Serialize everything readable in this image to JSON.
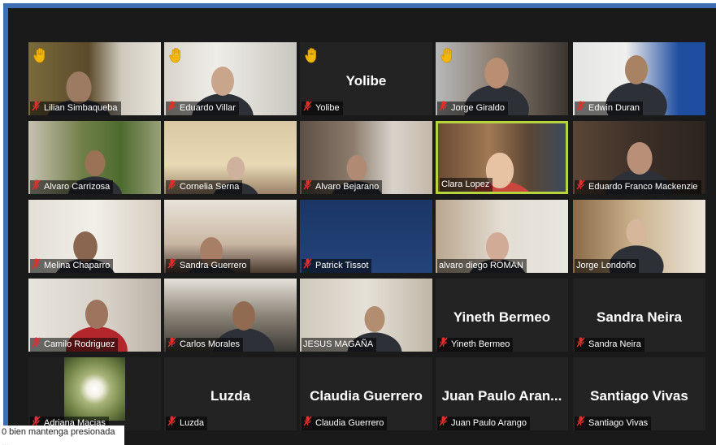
{
  "meeting": {
    "participants": [
      {
        "name": "Lilian Simbaqueba",
        "hand_raised": true,
        "mic": "muted-icon",
        "video": true
      },
      {
        "name": "Eduardo Villar",
        "hand_raised": true,
        "mic": "muted-icon",
        "video": true
      },
      {
        "name": "Yolibe",
        "hand_raised": true,
        "mic": "muted-icon",
        "video": false,
        "display_text": "Yolibe"
      },
      {
        "name": "Jorge Giraldo",
        "hand_raised": true,
        "mic": "muted-icon",
        "video": true
      },
      {
        "name": "Edwin Duran",
        "hand_raised": false,
        "mic": "muted-icon",
        "video": true
      },
      {
        "name": "Alvaro Carrizosa",
        "hand_raised": false,
        "mic": "muted-icon",
        "video": true
      },
      {
        "name": "Cornelia Serna",
        "hand_raised": false,
        "mic": "muted-icon",
        "video": true
      },
      {
        "name": "Alvaro Bejarano",
        "hand_raised": false,
        "mic": "muted-icon",
        "video": true
      },
      {
        "name": "Clara Lopez",
        "hand_raised": false,
        "mic": "none",
        "video": true,
        "active_speaker": true
      },
      {
        "name": "Eduardo Franco Mackenzie",
        "hand_raised": false,
        "mic": "muted-icon",
        "video": true
      },
      {
        "name": "Melina Chaparro",
        "hand_raised": false,
        "mic": "muted-icon",
        "video": true
      },
      {
        "name": "Sandra Guerrero",
        "hand_raised": false,
        "mic": "muted-icon",
        "video": true
      },
      {
        "name": "Patrick Tissot",
        "hand_raised": false,
        "mic": "muted-icon",
        "video": true
      },
      {
        "name": "alvaro diego ROMAN",
        "hand_raised": false,
        "mic": "none",
        "video": true
      },
      {
        "name": "Jorge Londoño",
        "hand_raised": false,
        "mic": "none",
        "video": true
      },
      {
        "name": "Camilo Rodriguez",
        "hand_raised": false,
        "mic": "muted-icon",
        "video": true
      },
      {
        "name": "Carlos Morales",
        "hand_raised": false,
        "mic": "muted-icon",
        "video": true
      },
      {
        "name": "JESUS MAGAÑA",
        "hand_raised": false,
        "mic": "none",
        "video": true
      },
      {
        "name": "Yineth Bermeo",
        "hand_raised": false,
        "mic": "muted-icon",
        "video": false,
        "display_text": "Yineth Bermeo"
      },
      {
        "name": "Sandra Neira",
        "hand_raised": false,
        "mic": "muted-icon",
        "video": false,
        "display_text": "Sandra Neira"
      },
      {
        "name": "Adriana Macias",
        "hand_raised": false,
        "mic": "muted-icon",
        "video": true
      },
      {
        "name": "Luzda",
        "hand_raised": false,
        "mic": "muted-icon",
        "video": false,
        "display_text": "Luzda"
      },
      {
        "name": "Claudia Guerrero",
        "hand_raised": false,
        "mic": "muted-icon",
        "video": false,
        "display_text": "Claudia Guerrero"
      },
      {
        "name": "Juan Paulo Arango",
        "hand_raised": false,
        "mic": "muted-icon",
        "video": false,
        "display_text": "Juan Paulo Aran..."
      },
      {
        "name": "Santiago Vivas",
        "hand_raised": false,
        "mic": "muted-icon",
        "video": false,
        "display_text": "Santiago Vivas"
      }
    ],
    "tooltip": {
      "line1": "0 bien mantenga presionada",
      "line2": "..."
    },
    "colors": {
      "frame": "#3d6fb5",
      "stage": "#1a1a1a",
      "active_border": "#b7d33d",
      "mic_muted": "#e0302c",
      "hand": "#f2b705"
    }
  }
}
